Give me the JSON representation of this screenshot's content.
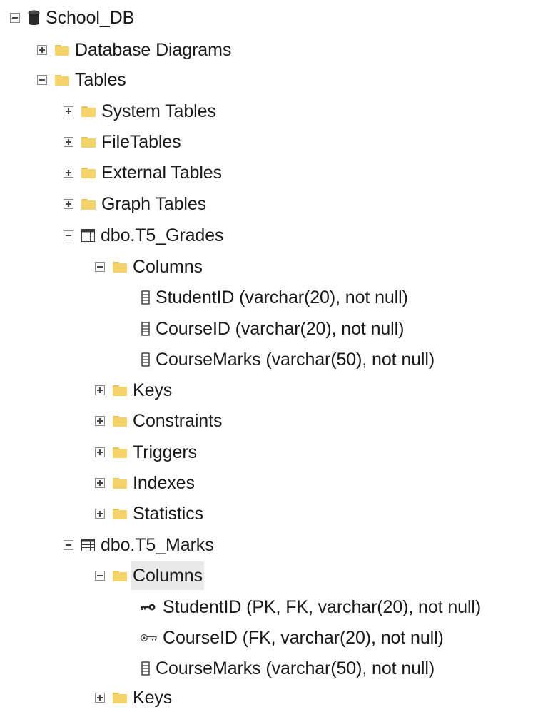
{
  "tree": {
    "root": {
      "label": "School_DB",
      "icon": "database-icon",
      "expanded": true
    },
    "database_diagrams": {
      "label": "Database Diagrams",
      "icon": "folder-icon",
      "expanded": false
    },
    "tables": {
      "label": "Tables",
      "icon": "folder-icon",
      "expanded": true
    },
    "system_tables": {
      "label": "System Tables",
      "icon": "folder-icon",
      "expanded": false
    },
    "file_tables": {
      "label": "FileTables",
      "icon": "folder-icon",
      "expanded": false
    },
    "external_tables": {
      "label": "External Tables",
      "icon": "folder-icon",
      "expanded": false
    },
    "graph_tables": {
      "label": "Graph Tables",
      "icon": "folder-icon",
      "expanded": false
    },
    "t5_grades": {
      "label": "dbo.T5_Grades",
      "icon": "table-icon",
      "expanded": true,
      "columns_folder": {
        "label": "Columns",
        "expanded": true
      },
      "columns": [
        {
          "label": "StudentID (varchar(20), not null)",
          "icon": "column-icon"
        },
        {
          "label": "CourseID (varchar(20), not null)",
          "icon": "column-icon"
        },
        {
          "label": "CourseMarks (varchar(50), not null)",
          "icon": "column-icon"
        }
      ],
      "folders": [
        {
          "label": "Keys",
          "expanded": false
        },
        {
          "label": "Constraints",
          "expanded": false
        },
        {
          "label": "Triggers",
          "expanded": false
        },
        {
          "label": "Indexes",
          "expanded": false
        },
        {
          "label": "Statistics",
          "expanded": false
        }
      ]
    },
    "t5_marks": {
      "label": "dbo.T5_Marks",
      "icon": "table-icon",
      "expanded": true,
      "columns_folder": {
        "label": "Columns",
        "expanded": true,
        "selected": true
      },
      "columns": [
        {
          "label": "StudentID (PK, FK, varchar(20), not null)",
          "icon": "primary-key-icon"
        },
        {
          "label": "CourseID (FK, varchar(20), not null)",
          "icon": "foreign-key-icon"
        },
        {
          "label": "CourseMarks (varchar(50), not null)",
          "icon": "column-icon"
        }
      ],
      "next_folder": {
        "label": "Keys",
        "expanded": false
      }
    }
  },
  "colors": {
    "folder": "#f5d36b",
    "folder_tab": "#e8c35c",
    "text": "#1a1a1a",
    "selection": "#e9e9e9",
    "toggle_border": "#8c8c8c"
  }
}
